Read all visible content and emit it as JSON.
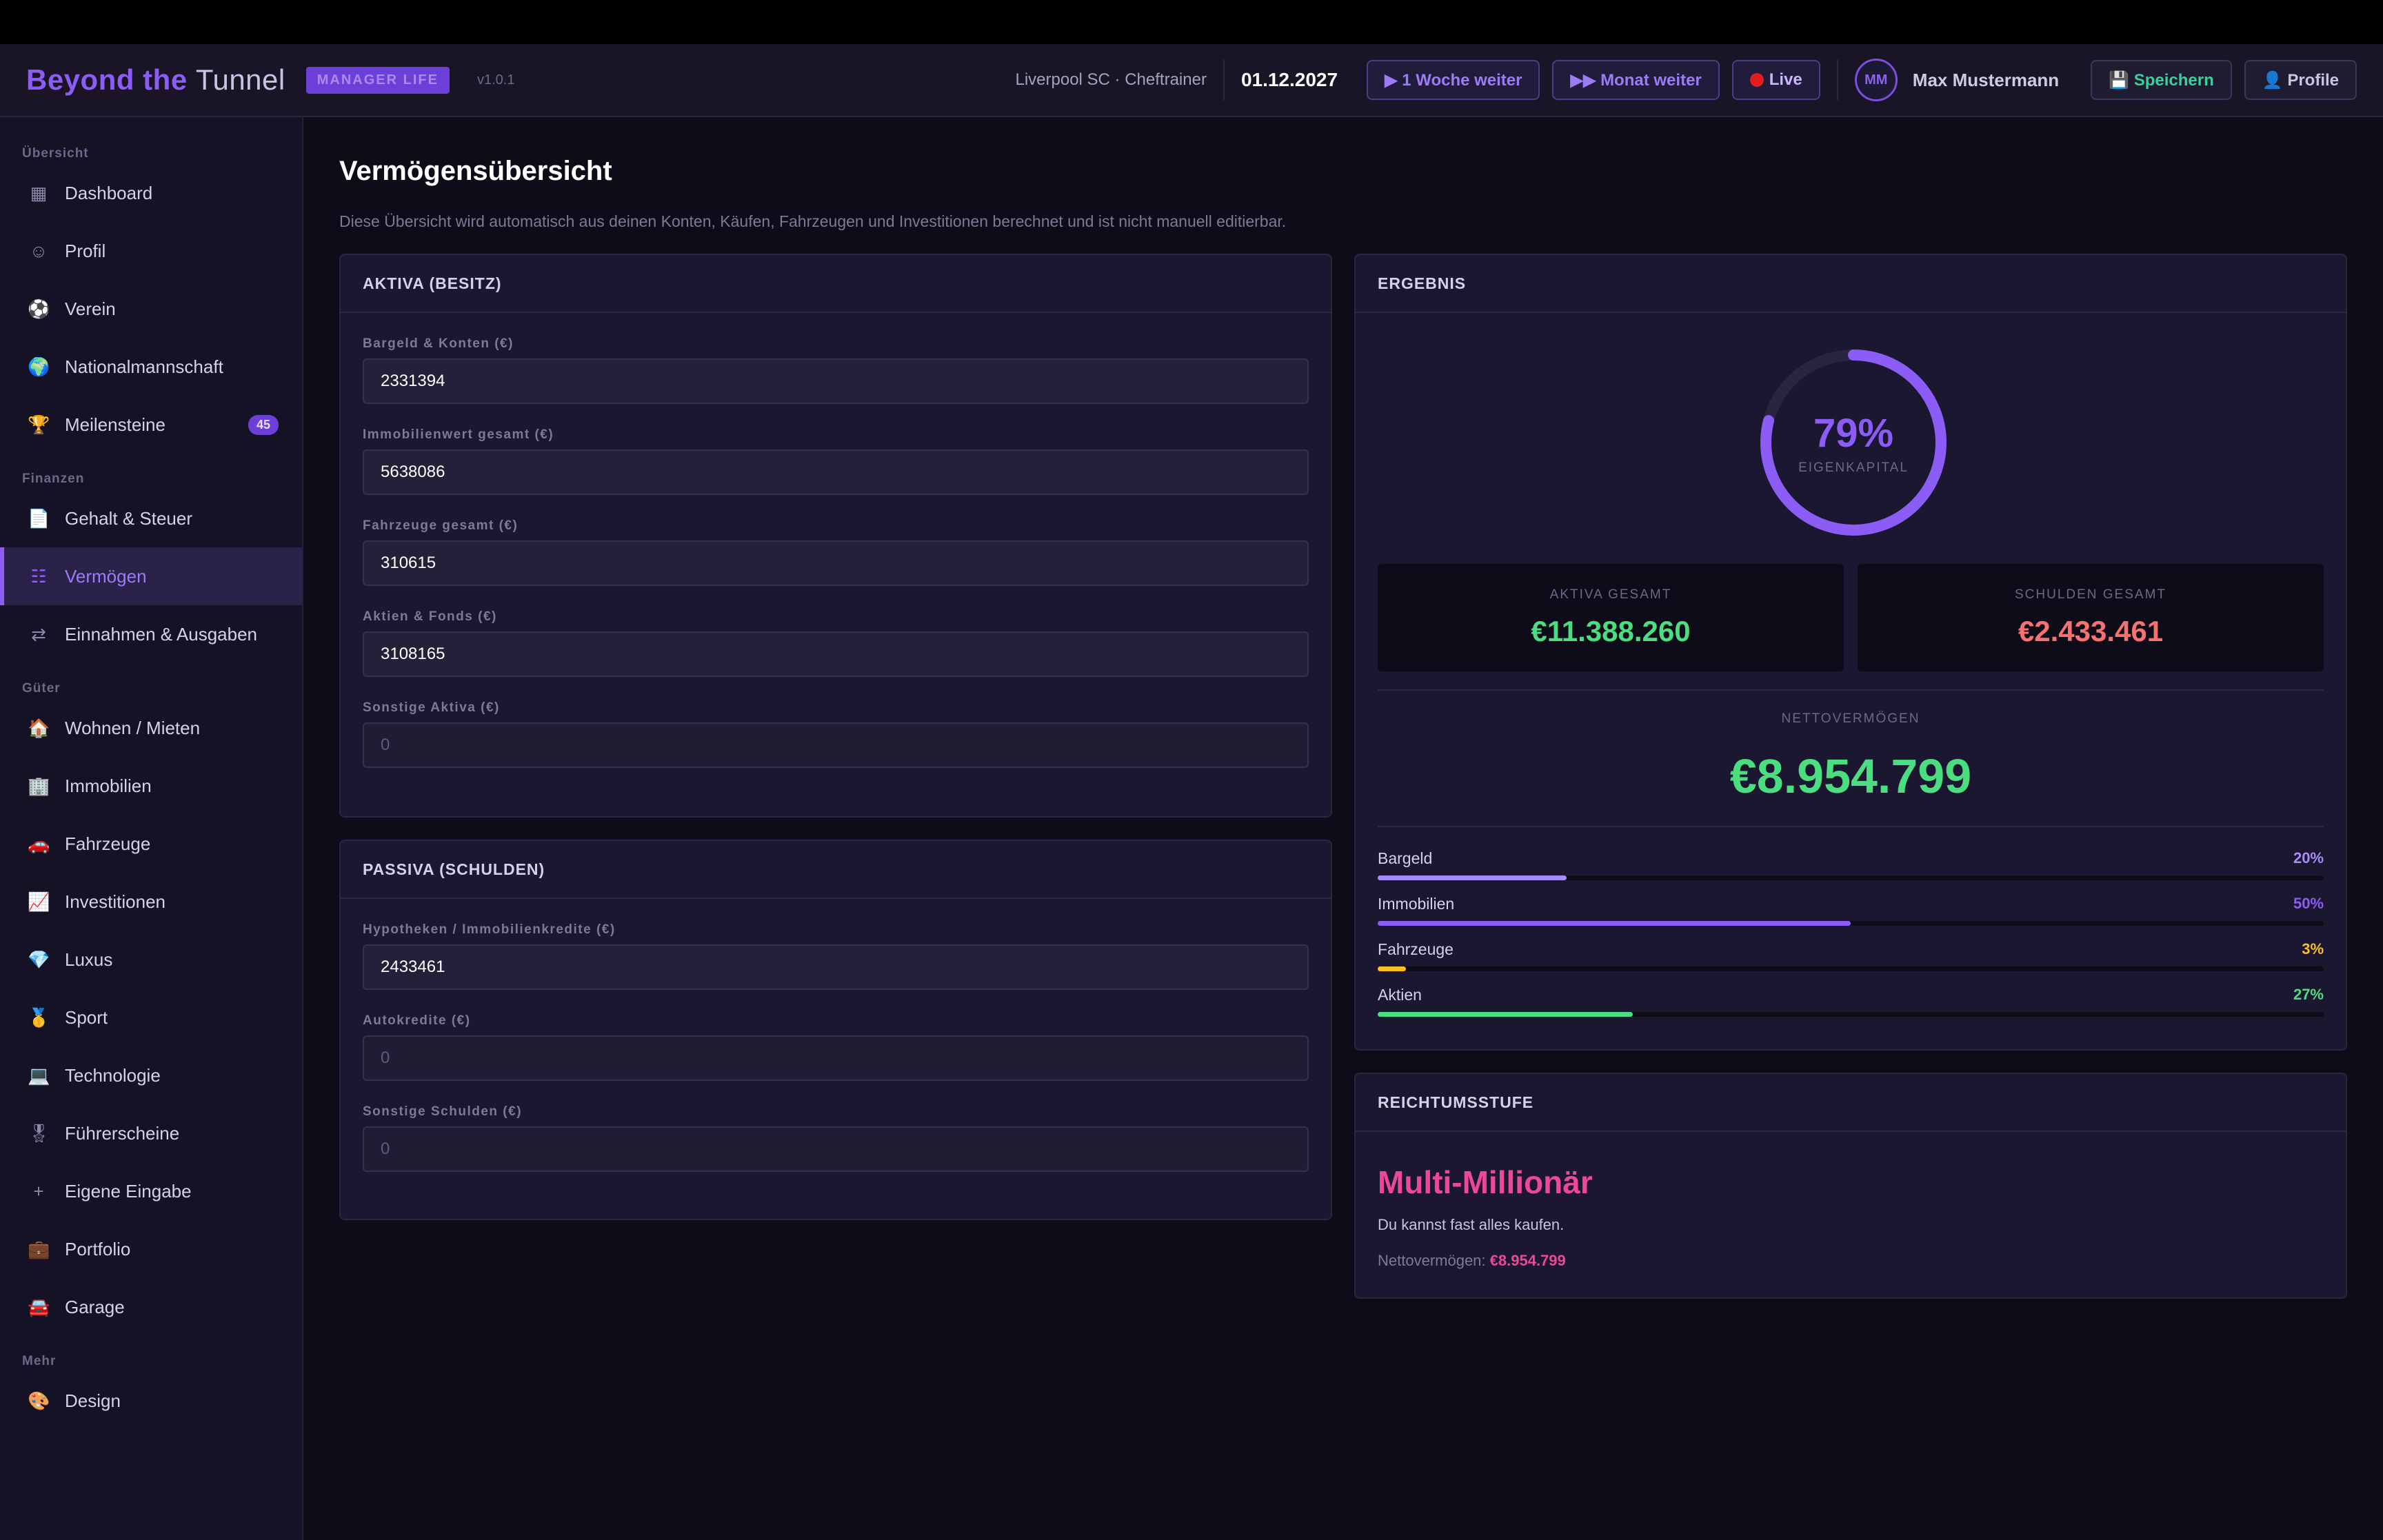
{
  "app": {
    "title_bold": "Beyond the",
    "title_light": "Tunnel",
    "badge": "MANAGER LIFE",
    "version": "v1.0.1"
  },
  "header": {
    "club": "Liverpool SC · Cheftrainer",
    "date": "01.12.2027",
    "week_btn": "▶ 1 Woche weiter",
    "month_btn": "▶▶ Monat weiter",
    "live_btn": "Live",
    "avatar_initials": "MM",
    "user_name": "Max Mustermann",
    "save_btn": "💾 Speichern",
    "profile_btn": "👤 Profile"
  },
  "sidebar": {
    "sections": [
      {
        "label": "Übersicht"
      },
      {
        "label": "Finanzen"
      },
      {
        "label": "Güter"
      },
      {
        "label": "Mehr"
      }
    ],
    "items": [
      {
        "icon": "▦",
        "label": "Dashboard"
      },
      {
        "icon": "☺",
        "label": "Profil"
      },
      {
        "icon": "⚽",
        "label": "Verein"
      },
      {
        "icon": "🌍",
        "label": "Nationalmannschaft"
      },
      {
        "icon": "🏆",
        "label": "Meilensteine",
        "count": "45"
      },
      {
        "icon": "📄",
        "label": "Gehalt & Steuer"
      },
      {
        "icon": "☷",
        "label": "Vermögen"
      },
      {
        "icon": "⇄",
        "label": "Einnahmen & Ausgaben"
      },
      {
        "icon": "🏠",
        "label": "Wohnen / Mieten"
      },
      {
        "icon": "🏢",
        "label": "Immobilien"
      },
      {
        "icon": "🚗",
        "label": "Fahrzeuge"
      },
      {
        "icon": "📈",
        "label": "Investitionen"
      },
      {
        "icon": "💎",
        "label": "Luxus"
      },
      {
        "icon": "🥇",
        "label": "Sport"
      },
      {
        "icon": "💻",
        "label": "Technologie"
      },
      {
        "icon": "🎖",
        "label": "Führerscheine"
      },
      {
        "icon": "+",
        "label": "Eigene Eingabe"
      },
      {
        "icon": "💼",
        "label": "Portfolio"
      },
      {
        "icon": "🚘",
        "label": "Garage"
      },
      {
        "icon": "🎨",
        "label": "Design"
      }
    ]
  },
  "page": {
    "title": "Vermögensübersicht",
    "description": "Diese Übersicht wird automatisch aus deinen Konten, Käufen, Fahrzeugen und Investitionen berechnet und ist nicht manuell editierbar."
  },
  "aktiva": {
    "header": "AKTIVA (BESITZ)",
    "fields": [
      {
        "label": "Bargeld & Konten (€)",
        "value": "2331394",
        "empty": false
      },
      {
        "label": "Immobilienwert gesamt (€)",
        "value": "5638086",
        "empty": false
      },
      {
        "label": "Fahrzeuge gesamt (€)",
        "value": "310615",
        "empty": false
      },
      {
        "label": "Aktien & Fonds (€)",
        "value": "3108165",
        "empty": false
      },
      {
        "label": "Sonstige Aktiva (€)",
        "value": "0",
        "empty": true
      }
    ]
  },
  "passiva": {
    "header": "PASSIVA (SCHULDEN)",
    "fields": [
      {
        "label": "Hypotheken / Immobilienkredite (€)",
        "value": "2433461",
        "empty": false
      },
      {
        "label": "Autokredite (€)",
        "value": "0",
        "empty": true
      },
      {
        "label": "Sonstige Schulden (€)",
        "value": "0",
        "empty": true
      }
    ]
  },
  "ergebnis": {
    "header": "ERGEBNIS",
    "equity_pct_label": "79%",
    "equity_fraction": 0.79,
    "equity_caption": "EIGENKAPITAL",
    "aktiva_label": "AKTIVA GESAMT",
    "aktiva_value": "€11.388.260",
    "schulden_label": "SCHULDEN GESAMT",
    "schulden_value": "€2.433.461",
    "net_label": "NETTOVERMÖGEN",
    "net_value": "€8.954.799",
    "breakdown": [
      {
        "name": "Bargeld",
        "pct_label": "20%",
        "fraction": 0.2,
        "color": "#a78bfa"
      },
      {
        "name": "Immobilien",
        "pct_label": "50%",
        "fraction": 0.5,
        "color": "#8b5cf6"
      },
      {
        "name": "Fahrzeuge",
        "pct_label": "3%",
        "fraction": 0.03,
        "color": "#fbbf24"
      },
      {
        "name": "Aktien",
        "pct_label": "27%",
        "fraction": 0.27,
        "color": "#4ade80"
      }
    ]
  },
  "reichtum": {
    "header": "REICHTUMSSTUFE",
    "level": "Multi-Millionär",
    "description": "Du kannst fast alles kaufen.",
    "net_prefix": "Nettovermögen:",
    "net_value": "€8.954.799"
  }
}
